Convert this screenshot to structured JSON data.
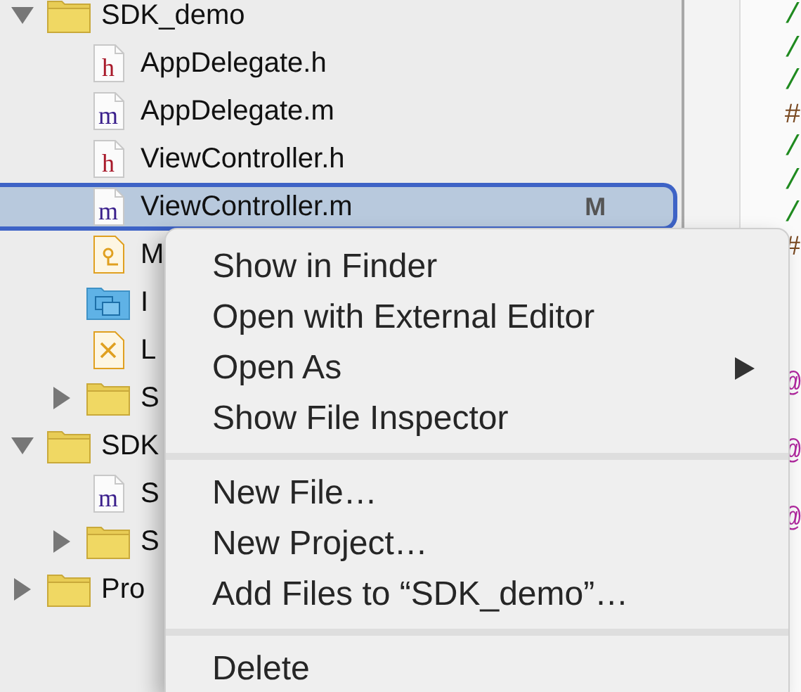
{
  "navigator": {
    "items": [
      {
        "label": "SDK_demo",
        "kind": "folder",
        "expanded": true,
        "selected": false,
        "children": [
          {
            "label": "AppDelegate.h",
            "kind": "header",
            "icon_text": "h",
            "selected": false
          },
          {
            "label": "AppDelegate.m",
            "kind": "source",
            "icon_text": "m",
            "selected": false
          },
          {
            "label": "ViewController.h",
            "kind": "header",
            "icon_text": "h",
            "selected": false
          },
          {
            "label": "ViewController.m",
            "kind": "source",
            "icon_text": "m",
            "selected": true,
            "badge": "M"
          },
          {
            "label": "M",
            "kind": "storyboard",
            "selected": false
          },
          {
            "label": "I",
            "kind": "assets",
            "selected": false
          },
          {
            "label": "L",
            "kind": "xib",
            "selected": false
          },
          {
            "label": "S",
            "kind": "folder",
            "expanded": false,
            "selected": false
          }
        ]
      },
      {
        "label": "SDK",
        "kind": "folder",
        "expanded": true,
        "selected": false,
        "children": [
          {
            "label": "S",
            "kind": "source",
            "icon_text": "m",
            "selected": false
          },
          {
            "label": "S",
            "kind": "folder",
            "expanded": false,
            "selected": false
          }
        ]
      },
      {
        "label": "Pro",
        "kind": "folder",
        "expanded": false,
        "selected": false
      }
    ]
  },
  "editor": {
    "lines": [
      {
        "text": "/",
        "kind": "comment"
      },
      {
        "text": "/",
        "kind": "comment"
      },
      {
        "text": "/",
        "kind": "comment"
      },
      {
        "text": "#",
        "kind": "directive"
      },
      {
        "text": "/",
        "kind": "comment"
      },
      {
        "text": "/",
        "kind": "comment"
      },
      {
        "text": "/",
        "kind": "comment"
      },
      {
        "text": "#",
        "kind": "directive"
      }
    ],
    "declarations": [
      {
        "text": "@",
        "kind": "keyword"
      },
      {
        "text": "@",
        "kind": "keyword"
      },
      {
        "text": "@",
        "kind": "keyword"
      }
    ]
  },
  "context_menu": {
    "groups": [
      [
        {
          "label": "Show in Finder"
        },
        {
          "label": "Open with External Editor"
        },
        {
          "label": "Open As",
          "submenu": true
        },
        {
          "label": "Show File Inspector"
        }
      ],
      [
        {
          "label": "New File…"
        },
        {
          "label": "New Project…"
        },
        {
          "label": "Add Files to “SDK_demo”…"
        }
      ],
      [
        {
          "label": "Delete"
        }
      ]
    ]
  }
}
